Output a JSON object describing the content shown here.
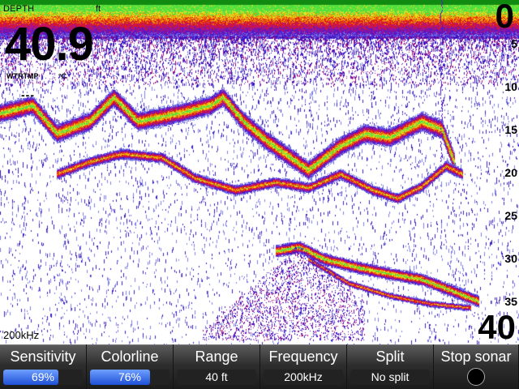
{
  "overlay": {
    "depth_label": "DEPTH",
    "depth_unit": "ft",
    "depth_value": "40.9",
    "watertemp_label": "WTRTMP",
    "watertemp_unit": "°C",
    "watertemp_value": "---",
    "range_top": "0",
    "range_bottom": "40",
    "frequency": "200kHz",
    "scale_ticks": [
      "5",
      "10",
      "15",
      "20",
      "25",
      "30",
      "35"
    ]
  },
  "menu": [
    {
      "label": "Sensitivity",
      "value": "69%",
      "level": 0.69
    },
    {
      "label": "Colorline",
      "value": "76%",
      "level": 0.76
    },
    {
      "label": "Range",
      "value": "40 ft"
    },
    {
      "label": "Frequency",
      "value": "200kHz"
    },
    {
      "label": "Split",
      "value": "No split"
    },
    {
      "label": "Stop sonar",
      "value": ""
    }
  ],
  "colors": {
    "surface_band": "#1a8a1a",
    "strong_return": "#e01a1a",
    "medium_return": "#f0a000",
    "weak_return": "#3a10c8",
    "level_fill": "#2a5fe0"
  }
}
